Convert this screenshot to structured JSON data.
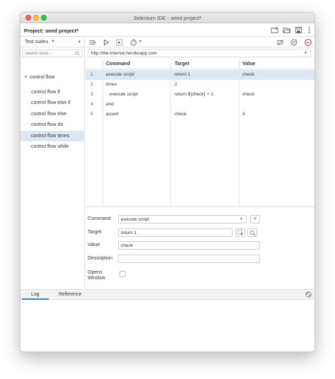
{
  "window": {
    "title": "Selenium IDE - seed project*"
  },
  "project": {
    "label": "Project:  seed project*",
    "icons": [
      "new-folder-icon",
      "open-folder-icon",
      "save-icon",
      "more-vertical-icon"
    ]
  },
  "sidebar": {
    "title": "Test suites",
    "search_placeholder": "Search tests...",
    "suite_name": "control flow",
    "tests": [
      {
        "label": "control flow if"
      },
      {
        "label": "control flow else if"
      },
      {
        "label": "control flow else"
      },
      {
        "label": "control flow do"
      },
      {
        "label": "control flow times"
      },
      {
        "label": "control flow while"
      }
    ],
    "selected_index": 4
  },
  "toolbar": {
    "left_icons": [
      "run-all-icon",
      "run-icon",
      "step-over-icon",
      "speed-icon"
    ],
    "right_icons": [
      "disable-breakpoints-icon",
      "pause-on-exceptions-icon",
      "record-icon"
    ],
    "record_label": "REC"
  },
  "base_url": "http://the-internet.herokuapp.com",
  "grid": {
    "headers": {
      "command": "Command",
      "target": "Target",
      "value": "Value"
    },
    "rows": [
      {
        "index": "1",
        "command": "execute script",
        "target": "return 1",
        "value": "check"
      },
      {
        "index": "2",
        "command": "times",
        "target": "2",
        "value": ""
      },
      {
        "index": "3",
        "command": "execute script",
        "target": "return ${check} + 1",
        "value": "check"
      },
      {
        "index": "4",
        "command": "end",
        "target": "",
        "value": ""
      },
      {
        "index": "5",
        "command": "assert",
        "target": "check",
        "value": "3"
      }
    ],
    "selected_row": 0
  },
  "detail": {
    "command_label": "Command",
    "command_value": "execute script",
    "comment_button": "#",
    "target_label": "Target",
    "target_value": "return 1",
    "value_label": "Value",
    "value_value": "check",
    "description_label": "Description",
    "description_value": "",
    "opens_window_label_1": "Opens",
    "opens_window_label_2": "Window"
  },
  "log": {
    "tabs": [
      {
        "label": "Log"
      },
      {
        "label": "Reference"
      }
    ],
    "active_tab": 0
  },
  "colors": {
    "accent": "#3a87c9",
    "selection": "#dbe8f4",
    "record": "#d0021b"
  }
}
